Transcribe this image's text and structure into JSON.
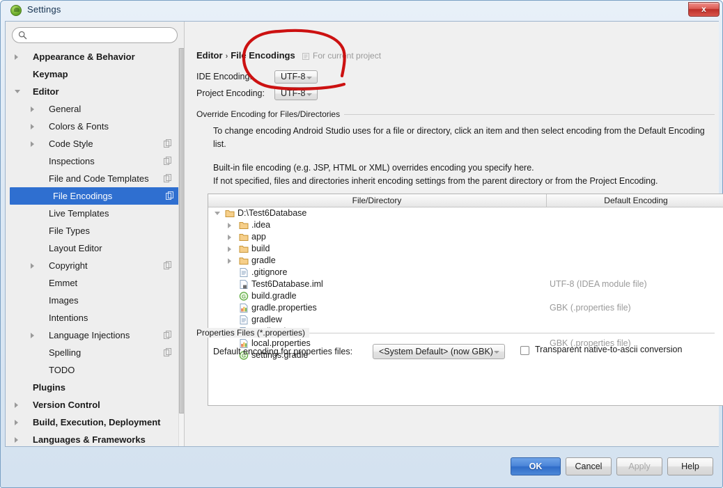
{
  "window": {
    "title": "Settings",
    "app_icon": "android-studio-icon",
    "close_label": "x"
  },
  "search": {
    "value": "",
    "placeholder": "",
    "icon": "search-icon"
  },
  "sidebar": {
    "items": [
      {
        "label": "Appearance & Behavior",
        "level": 0,
        "bold": true,
        "arrow": "collapsed",
        "badge": false,
        "selected": false
      },
      {
        "label": "Keymap",
        "level": 0,
        "bold": true,
        "arrow": "none",
        "badge": false,
        "selected": false
      },
      {
        "label": "Editor",
        "level": 0,
        "bold": true,
        "arrow": "expanded",
        "badge": false,
        "selected": false
      },
      {
        "label": "General",
        "level": 1,
        "bold": false,
        "arrow": "collapsed",
        "badge": false,
        "selected": false
      },
      {
        "label": "Colors & Fonts",
        "level": 1,
        "bold": false,
        "arrow": "collapsed",
        "badge": false,
        "selected": false
      },
      {
        "label": "Code Style",
        "level": 1,
        "bold": false,
        "arrow": "collapsed",
        "badge": true,
        "selected": false
      },
      {
        "label": "Inspections",
        "level": 1,
        "bold": false,
        "arrow": "none",
        "badge": true,
        "selected": false
      },
      {
        "label": "File and Code Templates",
        "level": 1,
        "bold": false,
        "arrow": "none",
        "badge": true,
        "selected": false
      },
      {
        "label": "File Encodings",
        "level": 1,
        "bold": false,
        "arrow": "none",
        "badge": true,
        "selected": true
      },
      {
        "label": "Live Templates",
        "level": 1,
        "bold": false,
        "arrow": "none",
        "badge": false,
        "selected": false
      },
      {
        "label": "File Types",
        "level": 1,
        "bold": false,
        "arrow": "none",
        "badge": false,
        "selected": false
      },
      {
        "label": "Layout Editor",
        "level": 1,
        "bold": false,
        "arrow": "none",
        "badge": false,
        "selected": false
      },
      {
        "label": "Copyright",
        "level": 1,
        "bold": false,
        "arrow": "collapsed",
        "badge": true,
        "selected": false
      },
      {
        "label": "Emmet",
        "level": 1,
        "bold": false,
        "arrow": "none",
        "badge": false,
        "selected": false
      },
      {
        "label": "Images",
        "level": 1,
        "bold": false,
        "arrow": "none",
        "badge": false,
        "selected": false
      },
      {
        "label": "Intentions",
        "level": 1,
        "bold": false,
        "arrow": "none",
        "badge": false,
        "selected": false
      },
      {
        "label": "Language Injections",
        "level": 1,
        "bold": false,
        "arrow": "collapsed",
        "badge": true,
        "selected": false
      },
      {
        "label": "Spelling",
        "level": 1,
        "bold": false,
        "arrow": "none",
        "badge": true,
        "selected": false
      },
      {
        "label": "TODO",
        "level": 1,
        "bold": false,
        "arrow": "none",
        "badge": false,
        "selected": false
      },
      {
        "label": "Plugins",
        "level": 0,
        "bold": true,
        "arrow": "none",
        "badge": false,
        "selected": false
      },
      {
        "label": "Version Control",
        "level": 0,
        "bold": true,
        "arrow": "collapsed",
        "badge": false,
        "selected": false
      },
      {
        "label": "Build, Execution, Deployment",
        "level": 0,
        "bold": true,
        "arrow": "collapsed",
        "badge": false,
        "selected": false
      },
      {
        "label": "Languages & Frameworks",
        "level": 0,
        "bold": true,
        "arrow": "collapsed",
        "badge": false,
        "selected": false
      }
    ]
  },
  "main": {
    "breadcrumb": {
      "parent": "Editor",
      "separator": "›",
      "current": "File Encodings"
    },
    "scope_note": "For current project",
    "ide_encoding": {
      "label": "IDE Encoding:",
      "value": "UTF-8"
    },
    "project_encoding": {
      "label": "Project Encoding:",
      "value": "UTF-8"
    },
    "override_group": {
      "title": "Override Encoding for Files/Directories",
      "paragraph1": "To change encoding Android Studio uses for a file or directory, click an item and then select encoding from the Default Encoding list.",
      "paragraph2": "Built-in file encoding (e.g. JSP, HTML or XML) overrides encoding you specify here.",
      "paragraph3": "If not specified, files and directories inherit encoding settings from the parent directory or from the Project Encoding."
    },
    "table": {
      "columns": [
        "File/Directory",
        "Default Encoding"
      ],
      "rows": [
        {
          "name": "D:\\Test6Database",
          "depth": 0,
          "icon": "folder-icon",
          "arrow": "expanded",
          "encoding": ""
        },
        {
          "name": ".idea",
          "depth": 1,
          "icon": "folder-icon",
          "arrow": "collapsed",
          "encoding": ""
        },
        {
          "name": "app",
          "depth": 1,
          "icon": "folder-icon",
          "arrow": "collapsed",
          "encoding": ""
        },
        {
          "name": "build",
          "depth": 1,
          "icon": "folder-icon",
          "arrow": "collapsed",
          "encoding": ""
        },
        {
          "name": "gradle",
          "depth": 1,
          "icon": "folder-icon",
          "arrow": "collapsed",
          "encoding": ""
        },
        {
          "name": ".gitignore",
          "depth": 1,
          "icon": "text-file-icon",
          "arrow": "none",
          "encoding": ""
        },
        {
          "name": "Test6Database.iml",
          "depth": 1,
          "icon": "iml-module-file-icon",
          "arrow": "none",
          "encoding": "UTF-8 (IDEA module file)"
        },
        {
          "name": "build.gradle",
          "depth": 1,
          "icon": "gradle-file-icon",
          "arrow": "none",
          "encoding": ""
        },
        {
          "name": "gradle.properties",
          "depth": 1,
          "icon": "properties-file-icon",
          "arrow": "none",
          "encoding": "GBK (.properties file)"
        },
        {
          "name": "gradlew",
          "depth": 1,
          "icon": "text-file-icon",
          "arrow": "none",
          "encoding": ""
        },
        {
          "name": "gradlew.bat",
          "depth": 1,
          "icon": "text-file-icon",
          "arrow": "none",
          "encoding": ""
        },
        {
          "name": "local.properties",
          "depth": 1,
          "icon": "properties-file-icon",
          "arrow": "none",
          "encoding": "GBK (.properties file)"
        },
        {
          "name": "settings.gradle",
          "depth": 1,
          "icon": "gradle-file-icon",
          "arrow": "none",
          "encoding": ""
        }
      ]
    },
    "properties_group": {
      "title": "Properties Files (*.properties)",
      "default_encoding_label": "Default encoding for properties files:",
      "default_encoding_value": "<System Default> (now GBK)",
      "transparent_checkbox_label": "Transparent native-to-ascii conversion",
      "transparent_checked": false
    }
  },
  "buttons": {
    "ok": "OK",
    "cancel": "Cancel",
    "apply": "Apply",
    "help": "Help"
  },
  "annotation": {
    "type": "hand-drawn-red-oval",
    "color": "#cc1111"
  },
  "colors": {
    "selection_blue": "#2f6fd0",
    "primary_button_blue": "#2f6cc8",
    "annotation_red": "#cc1111",
    "muted_text": "#9a9a9a"
  }
}
